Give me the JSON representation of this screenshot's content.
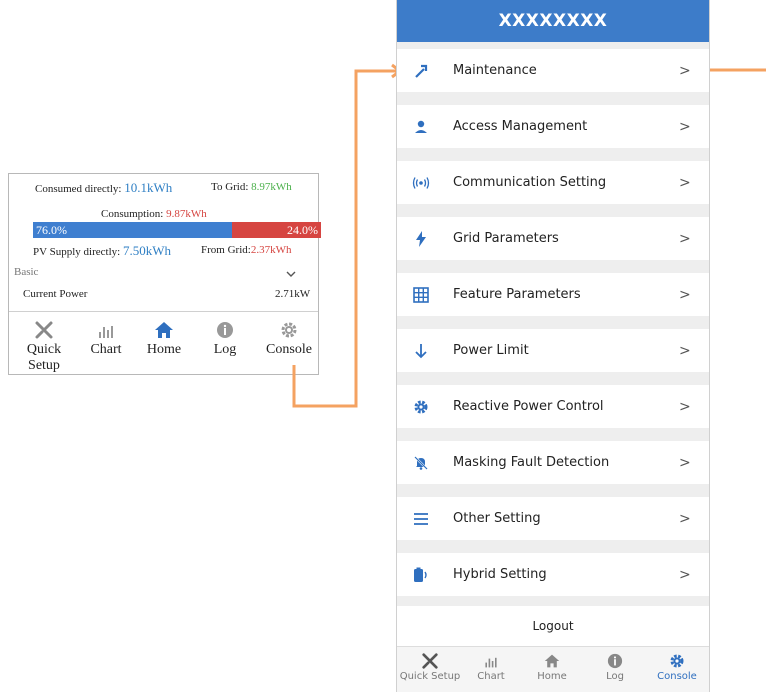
{
  "mini_panel": {
    "consumed_label": "Consumed directly:",
    "consumed_value": "10.1kWh",
    "to_grid_label": "To Grid:",
    "to_grid_value": "8.97kWh",
    "consumption_label": "Consumption:",
    "consumption_value": "9.87kWh",
    "bar_left": "76.0%",
    "bar_right": "24.0%",
    "pv_label": "PV Supply directly:",
    "pv_value": "7.50kWh",
    "from_grid_label": "From Grid:",
    "from_grid_value": "2.37kWh",
    "basic_label": "Basic",
    "current_power_label": "Current Power",
    "current_power_value": "2.71kW",
    "nav": [
      {
        "label": "Quick Setup",
        "icon": "tools-icon"
      },
      {
        "label": "Chart",
        "icon": "chart-icon"
      },
      {
        "label": "Home",
        "icon": "home-icon"
      },
      {
        "label": "Log",
        "icon": "info-icon"
      },
      {
        "label": "Console",
        "icon": "gear-icon"
      }
    ]
  },
  "phone": {
    "title": "XXXXXXXX",
    "menu": [
      {
        "label": "Maintenance",
        "icon": "hammer-icon"
      },
      {
        "label": "Access Management",
        "icon": "person-icon"
      },
      {
        "label": "Communication Setting",
        "icon": "signal-icon"
      },
      {
        "label": "Grid Parameters",
        "icon": "lightning-icon"
      },
      {
        "label": "Feature Parameters",
        "icon": "grid-icon"
      },
      {
        "label": "Power Limit",
        "icon": "arrow-down-icon"
      },
      {
        "label": "Reactive Power Control",
        "icon": "gear-icon"
      },
      {
        "label": "Masking Fault Detection",
        "icon": "bell-off-icon"
      },
      {
        "label": "Other Setting",
        "icon": "menu-icon"
      },
      {
        "label": "Hybrid Setting",
        "icon": "battery-icon"
      }
    ],
    "chevron": ">",
    "logout": "Logout",
    "nav": [
      {
        "label": "Quick Setup",
        "icon": "tools-icon"
      },
      {
        "label": "Chart",
        "icon": "chart-icon"
      },
      {
        "label": "Home",
        "icon": "home-icon"
      },
      {
        "label": "Log",
        "icon": "info-icon"
      },
      {
        "label": "Console",
        "icon": "gear-icon"
      }
    ],
    "active_color": "#2f6fbf",
    "header_color": "#3d7cc9"
  },
  "connector_color": "#f4a261"
}
